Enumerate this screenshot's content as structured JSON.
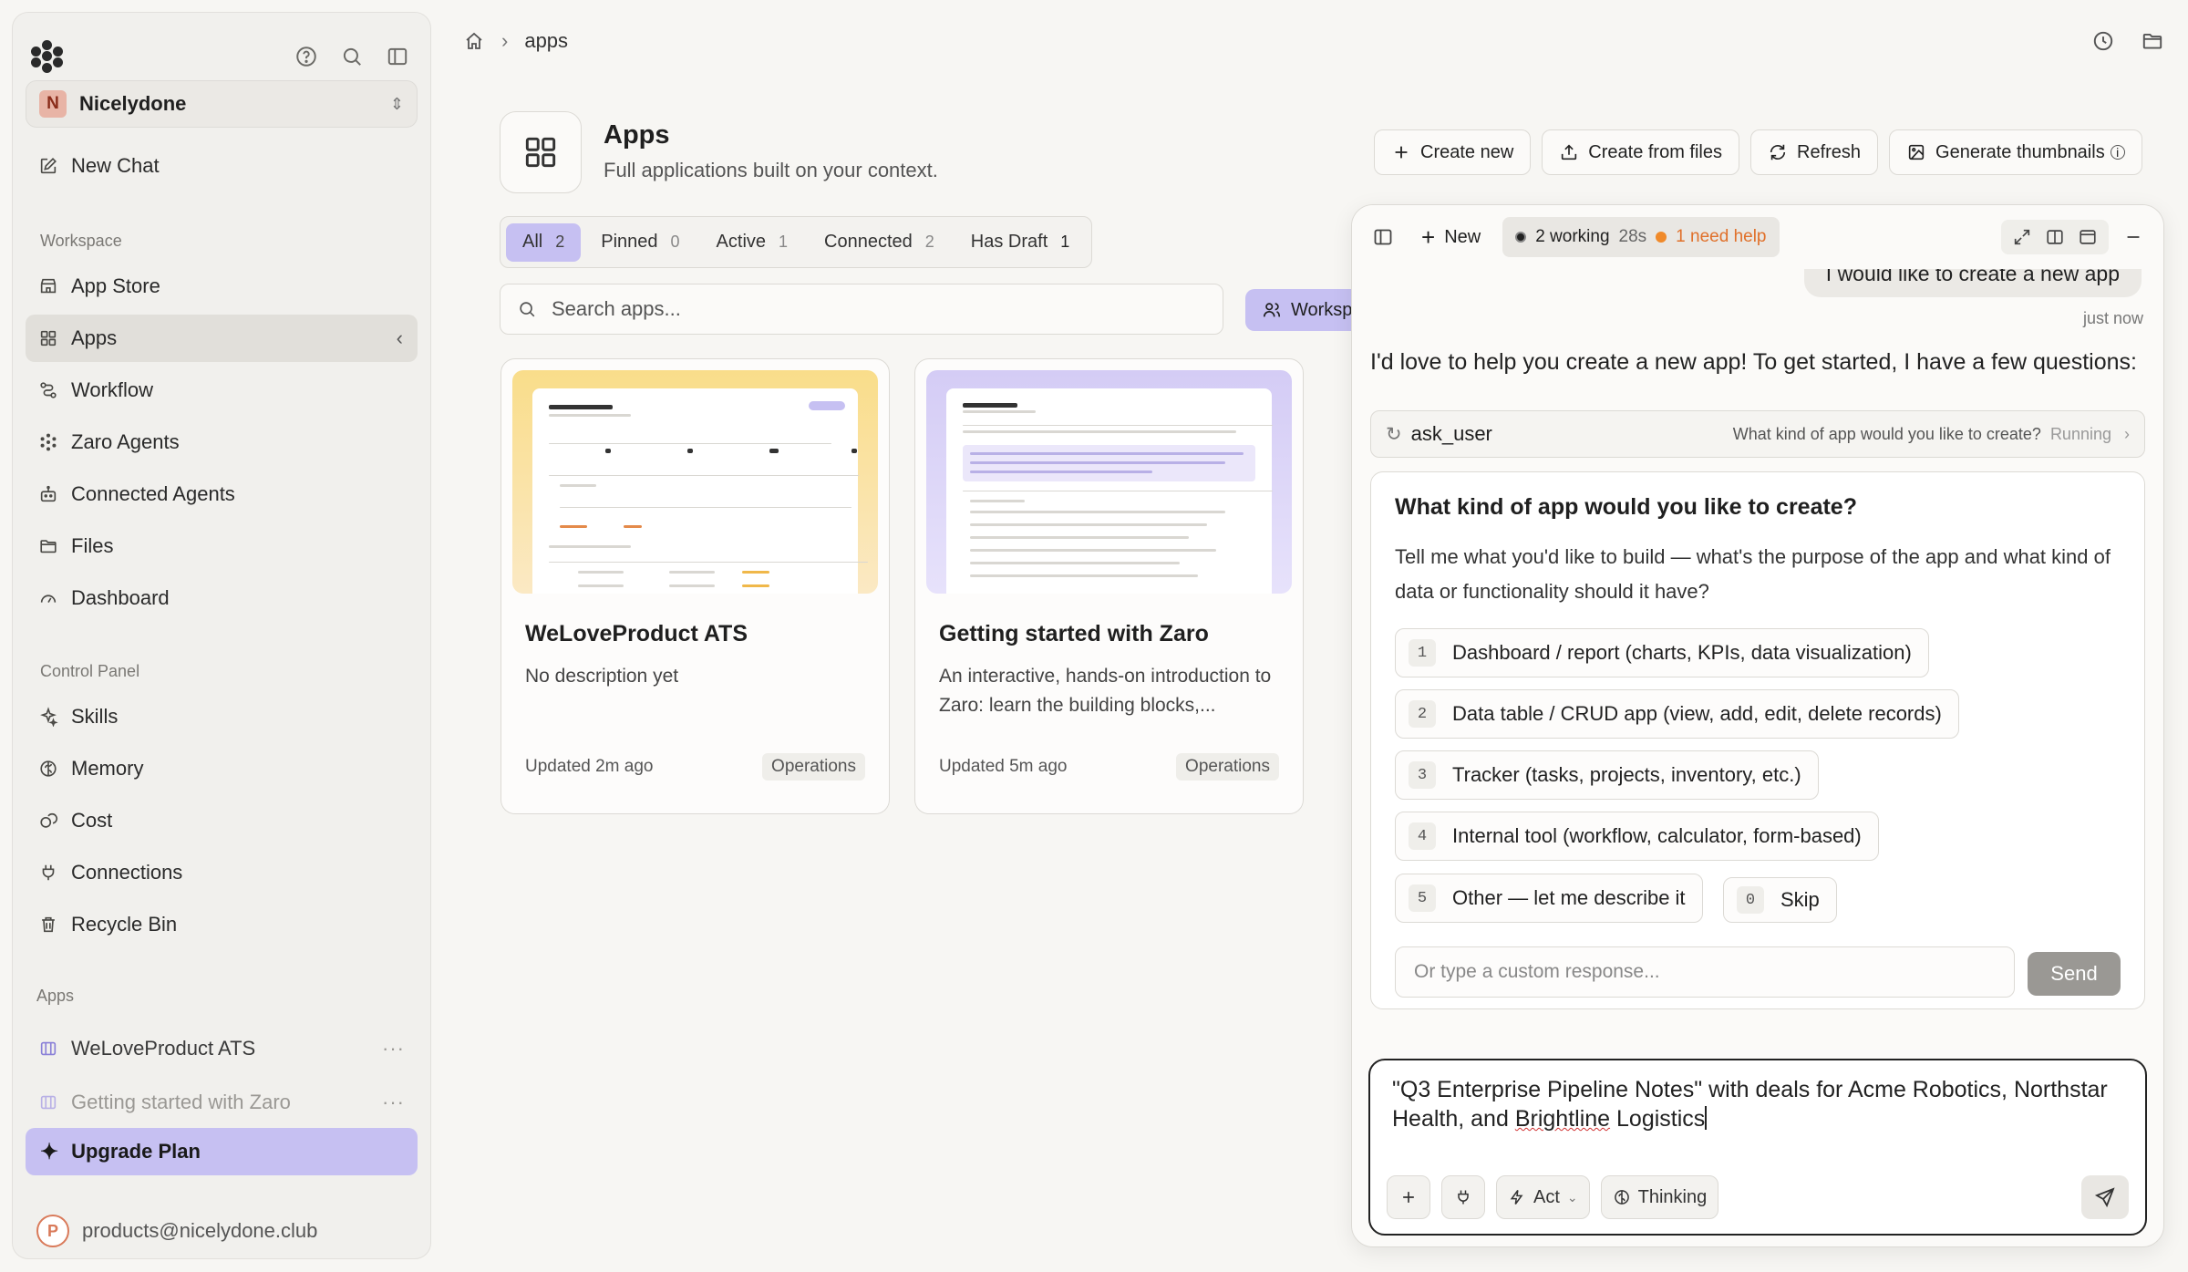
{
  "sidebar": {
    "org": {
      "initial": "N",
      "name": "Nicelydone"
    },
    "new_chat": "New Chat",
    "workspace_label": "Workspace",
    "workspace_items": [
      {
        "label": "App Store",
        "icon": "store-icon"
      },
      {
        "label": "Apps",
        "icon": "apps-grid-icon",
        "active": true
      },
      {
        "label": "Workflow",
        "icon": "workflow-icon"
      },
      {
        "label": "Zaro Agents",
        "icon": "agents-icon"
      },
      {
        "label": "Connected Agents",
        "icon": "robot-icon"
      },
      {
        "label": "Files",
        "icon": "folder-icon"
      },
      {
        "label": "Dashboard",
        "icon": "gauge-icon"
      }
    ],
    "control_label": "Control Panel",
    "control_items": [
      {
        "label": "Skills",
        "icon": "sparkle-icon"
      },
      {
        "label": "Memory",
        "icon": "brain-icon"
      },
      {
        "label": "Cost",
        "icon": "coins-icon"
      },
      {
        "label": "Connections",
        "icon": "plug-icon"
      },
      {
        "label": "Recycle Bin",
        "icon": "trash-icon"
      }
    ],
    "apps_label": "Apps",
    "app_items": [
      {
        "label": "WeLoveProduct ATS"
      },
      {
        "label": "Getting started with Zaro"
      }
    ],
    "upgrade": "Upgrade Plan",
    "user": {
      "initial": "P",
      "email": "products@nicelydone.club"
    }
  },
  "breadcrumb": {
    "current": "apps"
  },
  "page": {
    "title": "Apps",
    "subtitle": "Full applications built on your context.",
    "actions": {
      "create_new": "Create new",
      "create_from_files": "Create from files",
      "refresh": "Refresh",
      "generate_thumbnails": "Generate thumbnails"
    },
    "filters": [
      {
        "label": "All",
        "count": "2"
      },
      {
        "label": "Pinned",
        "count": "0"
      },
      {
        "label": "Active",
        "count": "1"
      },
      {
        "label": "Connected",
        "count": "2"
      },
      {
        "label": "Has Draft",
        "count": "1"
      }
    ],
    "search_placeholder": "Search apps...",
    "workspace_button": "Workspace",
    "cards": [
      {
        "title": "WeLoveProduct ATS",
        "description": "No description yet",
        "updated": "Updated 2m ago",
        "tag": "Operations"
      },
      {
        "title": "Getting started with Zaro",
        "description": "An interactive, hands-on introduction to Zaro: learn the building blocks,...",
        "updated": "Updated 5m ago",
        "tag": "Operations"
      }
    ]
  },
  "chat": {
    "new_label": "New",
    "status": {
      "working": "2 working",
      "time": "28s",
      "help": "1 need help"
    },
    "user_message": "I would like to create a new app",
    "timestamp": "just now",
    "assistant_message": "I'd love to help you create a new app! To get started, I have a few questions:",
    "tool": {
      "name": "ask_user",
      "question": "What kind of app would you like to create?",
      "state": "Running"
    },
    "question": {
      "title": "What kind of app would you like to create?",
      "description": "Tell me what you'd like to build — what's the purpose of the app and what kind of data or functionality should it have?",
      "options": [
        {
          "num": "1",
          "label": "Dashboard / report (charts, KPIs, data visualization)"
        },
        {
          "num": "2",
          "label": "Data table / CRUD app (view, add, edit, delete records)"
        },
        {
          "num": "3",
          "label": "Tracker (tasks, projects, inventory, etc.)"
        },
        {
          "num": "4",
          "label": "Internal tool (workflow, calculator, form-based)"
        },
        {
          "num": "5",
          "label": "Other — let me describe it"
        }
      ],
      "skip": {
        "num": "0",
        "label": "Skip"
      },
      "custom_placeholder": "Or type a custom response...",
      "send": "Send"
    },
    "composer": {
      "text_before": "\"Q3 Enterprise Pipeline Notes\" with deals for Acme Robotics, Northstar Health, and ",
      "text_flagged": "Brightline",
      "text_after": " Logistics",
      "mode": "Act",
      "thinking": "Thinking"
    }
  }
}
